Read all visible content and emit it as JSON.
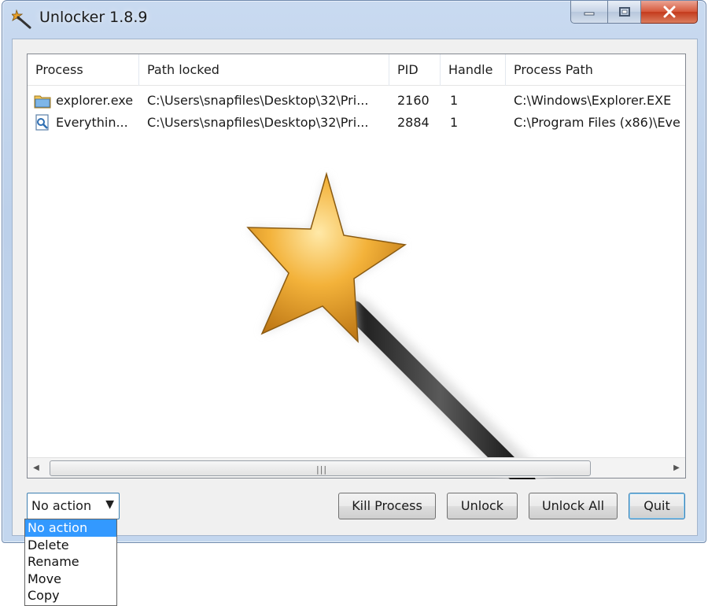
{
  "window": {
    "title": "Unlocker 1.8.9",
    "app_icon": "unlocker-wand-icon"
  },
  "caption_buttons": {
    "minimize_icon": "minimize-icon",
    "maximize_icon": "maximize-icon",
    "close_icon": "close-icon"
  },
  "columns": [
    {
      "label": "Process"
    },
    {
      "label": "Path locked"
    },
    {
      "label": "PID"
    },
    {
      "label": "Handle"
    },
    {
      "label": "Process Path"
    }
  ],
  "rows": [
    {
      "icon": "explorer-folder-icon",
      "process": "explorer.exe",
      "path_locked": "C:\\Users\\snapfiles\\Desktop\\32\\Pri...",
      "pid": "2160",
      "handle": "1",
      "process_path": "C:\\Windows\\Explorer.EXE"
    },
    {
      "icon": "everything-search-icon",
      "process": "Everythin...",
      "path_locked": "C:\\Users\\snapfiles\\Desktop\\32\\Pri...",
      "pid": "2884",
      "handle": "1",
      "process_path": "C:\\Program Files (x86)\\Eve"
    }
  ],
  "action_combo": {
    "selected": "No action",
    "options": [
      "No action",
      "Delete",
      "Rename",
      "Move",
      "Copy"
    ]
  },
  "buttons": {
    "kill_process": "Kill Process",
    "unlock": "Unlock",
    "unlock_all": "Unlock All",
    "quit": "Quit"
  },
  "colors": {
    "selection": "#3399ff",
    "star": "#f0a92a",
    "frame": "#c3d6ee"
  }
}
